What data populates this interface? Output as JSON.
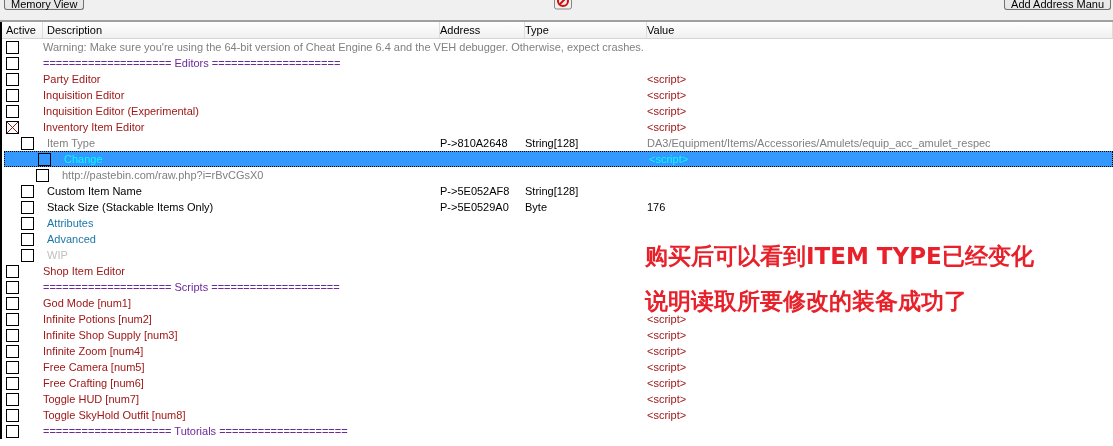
{
  "toolbar": {
    "left_button": "Memory View",
    "right_button": "Add Address Manu"
  },
  "table": {
    "columns": [
      "Active",
      "Description",
      "Address",
      "Type",
      "Value"
    ],
    "rows": [
      {
        "description": "Warning: Make sure you're using the 64-bit version of Cheat Engine 6.4 and the VEH debugger. Otherwise, expect crashes.",
        "color": "#808080",
        "checked": false,
        "selected": false
      },
      {
        "description": "==================== Editors ====================",
        "color": "#6a2a9a",
        "checked": false,
        "selected": false
      },
      {
        "description": "Party Editor",
        "color": "#a01818",
        "value": "<script>",
        "checked": false,
        "selected": false
      },
      {
        "description": "Inquisition Editor",
        "color": "#a01818",
        "value": "<script>",
        "checked": false,
        "selected": false
      },
      {
        "description": "Inquisition Editor (Experimental)",
        "color": "#a01818",
        "value": "<script>",
        "checked": false,
        "selected": false
      },
      {
        "description": "Inventory Item Editor",
        "color": "#a01818",
        "value": "<script>",
        "checked": true,
        "selected": false,
        "children": [
          {
            "description": "Item Type",
            "color": "#808080",
            "address": "P->810A2648",
            "type": "String[128]",
            "value": "DA3/Equipment/Items/Accessories/Amulets/equip_acc_amulet_respec",
            "checked": false,
            "selected": false,
            "children": [
              {
                "description": "Change",
                "color": "#00ffff",
                "value": "<script>",
                "checked": false,
                "selected": true
              },
              {
                "description": "http://pastebin.com/raw.php?i=rBvCGsX0",
                "color": "#808080",
                "checked": false,
                "selected": false
              }
            ]
          },
          {
            "description": "Custom Item Name",
            "color": "#000000",
            "address": "P->5E052AF8",
            "type": "String[128]",
            "checked": false,
            "selected": false
          },
          {
            "description": "Stack Size (Stackable Items Only)",
            "color": "#000000",
            "address": "P->5E0529A0",
            "type": "Byte",
            "value": "176",
            "checked": false,
            "selected": false
          },
          {
            "description": "Attributes",
            "color": "#1a78a8",
            "checked": false,
            "selected": false
          },
          {
            "description": "Advanced",
            "color": "#1a78a8",
            "checked": false,
            "selected": false
          },
          {
            "description": "WIP",
            "color": "#c0c0c0",
            "checked": false,
            "selected": false
          }
        ]
      },
      {
        "description": "Shop Item Editor",
        "color": "#a01818",
        "checked": false,
        "selected": false
      },
      {
        "description": "==================== Scripts ====================",
        "color": "#6a2a9a",
        "checked": false,
        "selected": false
      },
      {
        "description": "God Mode [num1]",
        "color": "#a01818",
        "checked": false,
        "selected": false
      },
      {
        "description": "Infinite Potions [num2]",
        "color": "#a01818",
        "value": "<script>",
        "checked": false,
        "selected": false
      },
      {
        "description": "Infinite Shop Supply [num3]",
        "color": "#a01818",
        "value": "<script>",
        "checked": false,
        "selected": false
      },
      {
        "description": "Infinite Zoom [num4]",
        "color": "#a01818",
        "value": "<script>",
        "checked": false,
        "selected": false
      },
      {
        "description": "Free Camera [num5]",
        "color": "#a01818",
        "value": "<script>",
        "checked": false,
        "selected": false
      },
      {
        "description": "Free Crafting [num6]",
        "color": "#a01818",
        "value": "<script>",
        "checked": false,
        "selected": false
      },
      {
        "description": "Toggle HUD [num7]",
        "color": "#a01818",
        "value": "<script>",
        "checked": false,
        "selected": false
      },
      {
        "description": "Toggle SkyHold Outfit [num8]",
        "color": "#a01818",
        "value": "<script>",
        "checked": false,
        "selected": false
      },
      {
        "description": "==================== Tutorials ====================",
        "color": "#6a2a9a",
        "checked": false,
        "selected": false
      }
    ]
  },
  "annotation": [
    "购买后可以看到ITEM TYPE已经变化",
    "说明读取所要修改的装备成功了"
  ]
}
